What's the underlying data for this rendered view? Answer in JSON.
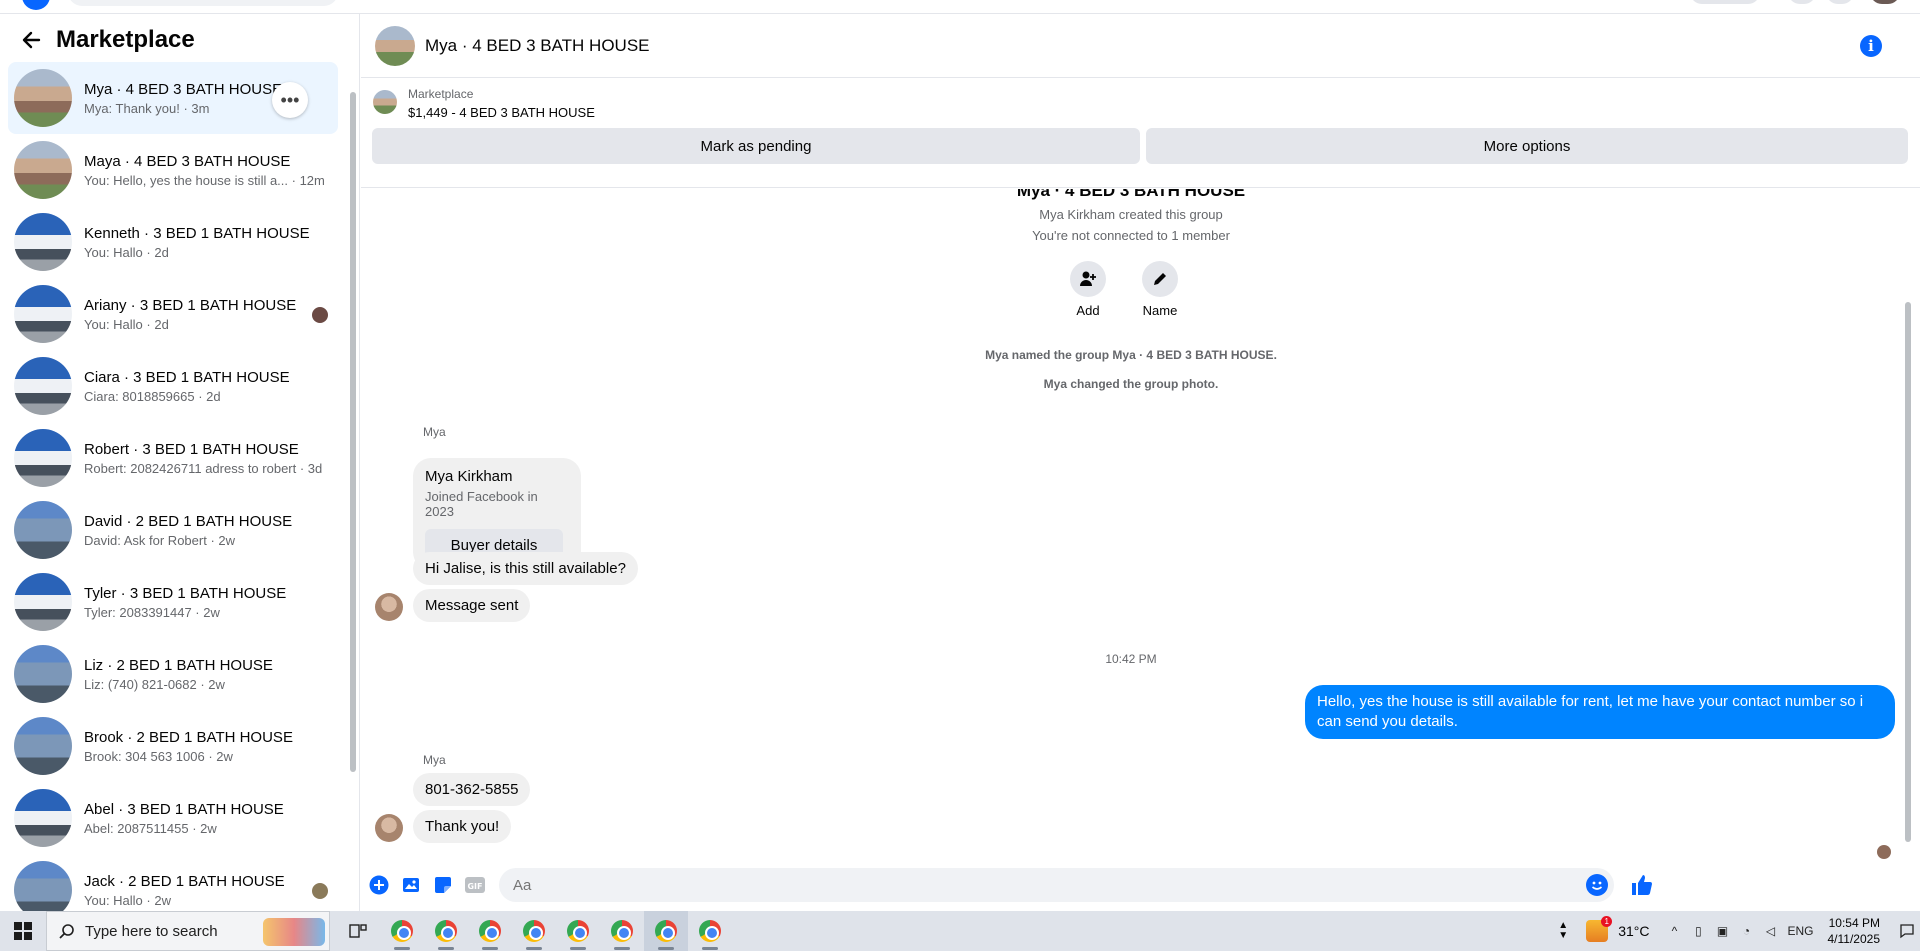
{
  "sidebar": {
    "title": "Marketplace",
    "conversations": [
      {
        "name": "Mya · 4 BED 3 BATH HOUSE",
        "preview": "Mya: Thank you! · 3m",
        "active": true
      },
      {
        "name": "Maya · 4 BED 3 BATH HOUSE",
        "preview": "You: Hello, yes the house is still a... · 12m"
      },
      {
        "name": "Kenneth · 3 BED 1 BATH HOUSE",
        "preview": "You: Hallo · 2d"
      },
      {
        "name": "Ariany · 3 BED 1 BATH HOUSE",
        "preview": "You: Hallo · 2d"
      },
      {
        "name": "Ciara · 3 BED 1 BATH HOUSE",
        "preview": "Ciara: 8018859665 · 2d"
      },
      {
        "name": "Robert · 3 BED 1 BATH HOUSE",
        "preview": "Robert: 2082426711 adress to robert · 3d"
      },
      {
        "name": "David · 2 BED 1 BATH HOUSE",
        "preview": "David: Ask for Robert · 2w"
      },
      {
        "name": "Tyler · 3 BED 1 BATH HOUSE",
        "preview": "Tyler: 2083391447 · 2w"
      },
      {
        "name": "Liz · 2 BED 1 BATH HOUSE",
        "preview": "Liz: (740) 821-0682 · 2w"
      },
      {
        "name": "Brook · 2 BED 1 BATH HOUSE",
        "preview": "Brook: 304 563 1006 · 2w"
      },
      {
        "name": "Abel · 3 BED 1 BATH HOUSE",
        "preview": "Abel: 2087511455 · 2w"
      },
      {
        "name": "Jack · 2 BED 1 BATH HOUSE",
        "preview": "You: Hallo · 2w"
      }
    ]
  },
  "chat": {
    "title": "Mya · 4 BED 3 BATH HOUSE",
    "marketplace_label": "Marketplace",
    "listing": "$1,449 - 4 BED 3 BATH HOUSE",
    "mark_pending": "Mark as pending",
    "more_options": "More options",
    "cut_title": "Mya · 4 BED 3 BATH HOUSE",
    "created": "Mya Kirkham created this group",
    "not_connected": "You're not connected to 1 member",
    "add_label": "Add",
    "name_label": "Name",
    "named_group": "Mya named the group Mya · 4 BED 3 BATH HOUSE.",
    "changed_photo": "Mya changed the group photo.",
    "sender1": "Mya",
    "buyer_name": "Mya Kirkham",
    "buyer_joined": "Joined Facebook in 2023",
    "buyer_details": "Buyer details",
    "msg1": "Hi Jalise, is this still available?",
    "msg2": "Message sent",
    "time": "10:42 PM",
    "out_msg": "Hello, yes the house is still available for rent, let me have your contact number so i can send you details.",
    "sender2": "Mya",
    "msg3": "801-362-5855",
    "msg4": "Thank you!",
    "input_placeholder": "Aa"
  },
  "taskbar": {
    "search_placeholder": "Type here to search",
    "temperature": "31°C",
    "weather_badge": "1",
    "language": "ENG",
    "time": "10:54 PM",
    "date": "4/11/2025"
  },
  "colors": {
    "accent": "#0866ff",
    "outgoing_bubble": "#0084ff",
    "active_row": "#ebf5ff"
  }
}
